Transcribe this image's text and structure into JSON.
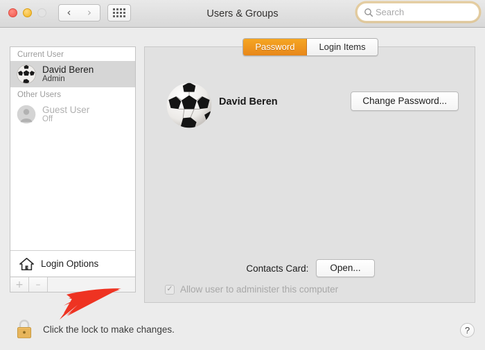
{
  "window": {
    "title": "Users & Groups",
    "traffic_lights": [
      {
        "name": "close",
        "color": "#f0554b",
        "enabled": true
      },
      {
        "name": "minimize",
        "color": "#f2b31c",
        "enabled": true
      },
      {
        "name": "maximize",
        "color": "#e3e3e3",
        "enabled": false
      }
    ]
  },
  "toolbar": {
    "back_icon": "chevron-left-icon",
    "back_glyph": "‹",
    "forward_icon": "chevron-right-icon",
    "forward_glyph": "›",
    "show_all_icon": "grid-icon",
    "search": {
      "placeholder": "Search",
      "value": "",
      "icon": "search-icon",
      "focus_ring_color": "#e2b664"
    }
  },
  "sidebar": {
    "groups": [
      {
        "header": "Current User",
        "users": [
          {
            "name": "David Beren",
            "subtitle": "Admin",
            "avatar": "soccer-ball-avatar",
            "selected": true,
            "enabled": true
          }
        ]
      },
      {
        "header": "Other Users",
        "users": [
          {
            "name": "Guest User",
            "subtitle": "Off",
            "avatar": "person-placeholder-avatar",
            "selected": false,
            "enabled": false
          }
        ]
      }
    ],
    "login_options": {
      "label": "Login Options",
      "icon": "home-icon"
    },
    "footer": {
      "add_label": "+",
      "remove_label": "–",
      "add_enabled": false,
      "remove_enabled": false
    }
  },
  "panel": {
    "tabs": [
      {
        "label": "Password",
        "active": true
      },
      {
        "label": "Login Items",
        "active": false
      }
    ],
    "account": {
      "avatar": "soccer-ball-avatar",
      "name": "David Beren",
      "change_password_label": "Change Password..."
    },
    "contacts_card": {
      "label": "Contacts Card:",
      "button_label": "Open..."
    },
    "admin_checkbox": {
      "label": "Allow user to administer this computer",
      "checked": true,
      "enabled": false,
      "check_glyph": "✓"
    }
  },
  "footer": {
    "lock": {
      "icon": "lock-closed-icon",
      "state": "locked",
      "color": "#e8b563"
    },
    "lock_text": "Click the lock to make changes.",
    "help_label": "?",
    "help_icon": "help-icon"
  },
  "annotation": {
    "arrow": {
      "color": "#ee3322",
      "points_to": "lock-button"
    }
  }
}
